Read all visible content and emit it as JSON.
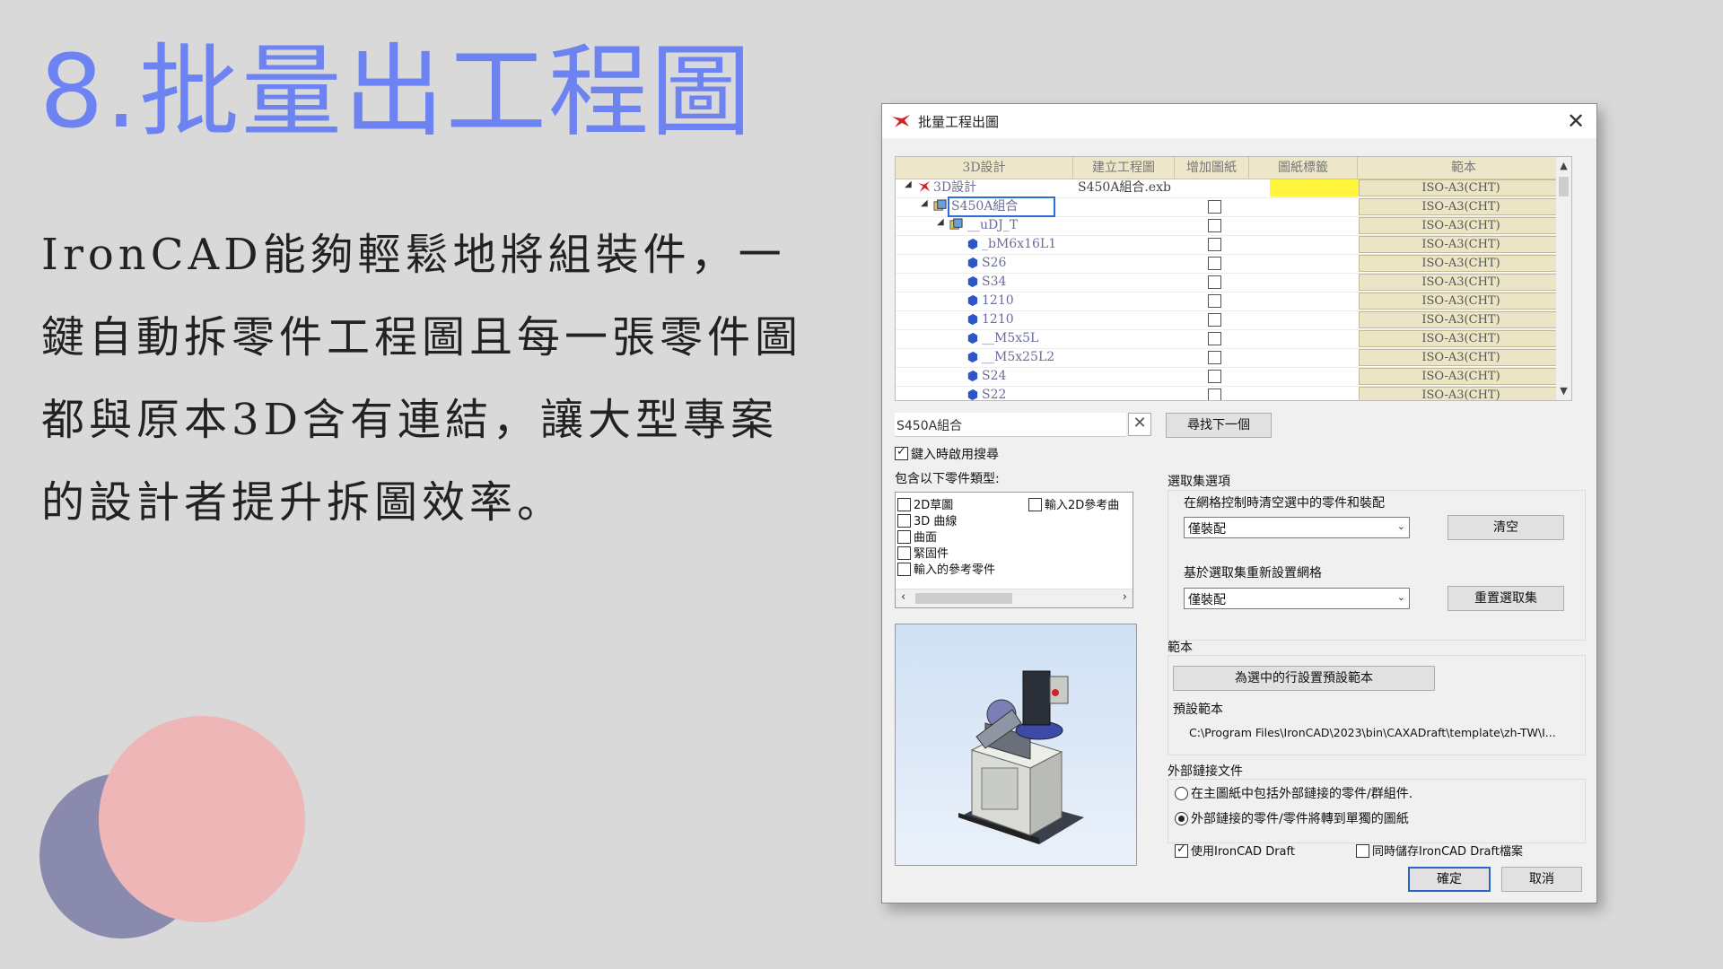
{
  "slide": {
    "title": "8.批量出工程圖",
    "body": "IronCAD能夠輕鬆地將組裝件，一鍵自動拆零件工程圖且每一張零件圖都與原本3D含有連結，讓大型專案的設計者提升拆圖效率。"
  },
  "dialog": {
    "title": "批量工程出圖",
    "close_label": "✕",
    "grid": {
      "columns": [
        "3D設計",
        "建立工程圖",
        "增加圖紙",
        "圖紙標籤",
        "範本"
      ],
      "rows": [
        {
          "name": "3D設計",
          "file": "S450A組合.exb",
          "template": "ISO-A3(CHT)"
        },
        {
          "name": "S450A組合",
          "template": "ISO-A3(CHT)"
        },
        {
          "name": "__uDJ_T",
          "template": "ISO-A3(CHT)"
        },
        {
          "name": "_bM6x16L1",
          "template": "ISO-A3(CHT)"
        },
        {
          "name": "S26",
          "template": "ISO-A3(CHT)"
        },
        {
          "name": "S34",
          "template": "ISO-A3(CHT)"
        },
        {
          "name": "1210",
          "template": "ISO-A3(CHT)"
        },
        {
          "name": "1210",
          "template": "ISO-A3(CHT)"
        },
        {
          "name": "__M5x5L",
          "template": "ISO-A3(CHT)"
        },
        {
          "name": "__M5x25L2",
          "template": "ISO-A3(CHT)"
        },
        {
          "name": "S24",
          "template": "ISO-A3(CHT)"
        },
        {
          "name": "S22",
          "template": "ISO-A3(CHT)"
        }
      ]
    },
    "search": {
      "value": "S450A組合",
      "clear_label": "✕",
      "find_next_label": "尋找下一個"
    },
    "enable_search_label": "鍵入時啟用搜尋",
    "include_types_label": "包含以下零件類型:",
    "part_types": [
      "2D草圖",
      "3D 曲線",
      "曲面",
      "緊固件",
      "輸入的參考零件"
    ],
    "input_2d_ref_label": "輸入2D參考曲",
    "selection_options": {
      "title": "選取集選項",
      "clear_label": "在網格控制時清空選中的零件和裝配",
      "clear_combo": "僅裝配",
      "clear_button": "清空",
      "reset_label": "基於選取集重新設置網格",
      "reset_combo": "僅裝配",
      "reset_button": "重置選取集"
    },
    "template_section": {
      "title": "範本",
      "set_default_button": "為選中的行設置預設範本",
      "default_label": "預設範本",
      "default_path": "C:\\Program Files\\IronCAD\\2023\\bin\\CAXADraft\\template\\zh-TW\\I..."
    },
    "external_links": {
      "title": "外部鏈接文件",
      "option1": "在主圖紙中包括外部鏈接的零件/群組件.",
      "option2": "外部鏈接的零件/零件將轉到單獨的圖紙"
    },
    "use_ironcad_draft_label": "使用IronCAD Draft",
    "save_draft_label": "同時儲存IronCAD Draft檔案",
    "ok_label": "確定",
    "cancel_label": "取消",
    "colors": {
      "template_cell": "#ece5c5",
      "highlight": "#fef53c",
      "ok_border": "#2a64c4"
    }
  }
}
